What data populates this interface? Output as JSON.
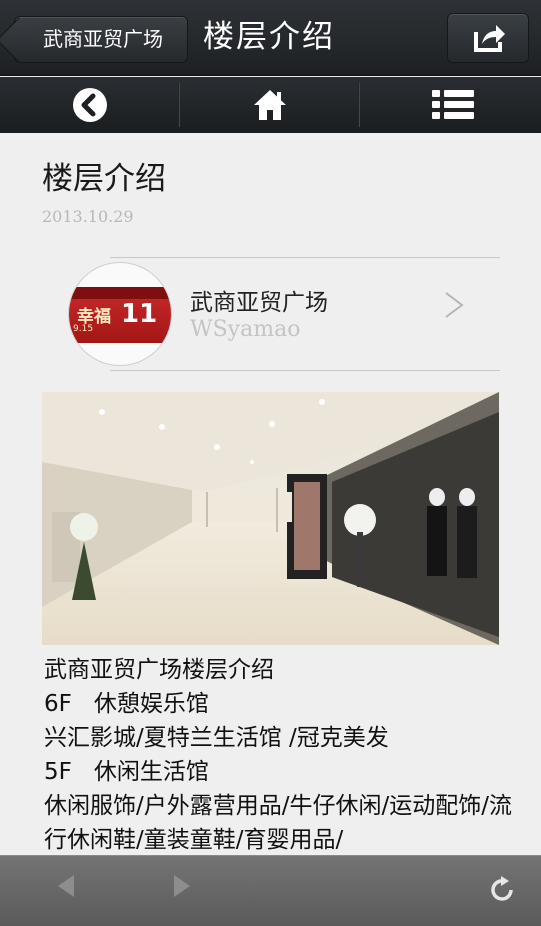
{
  "header": {
    "back_label": "武商亚贸广场",
    "title": "楼层介绍"
  },
  "nav": {
    "items": [
      {
        "icon": "back-circle-icon"
      },
      {
        "icon": "home-icon"
      },
      {
        "icon": "menu-list-icon"
      }
    ]
  },
  "article": {
    "title": "楼层介绍",
    "date": "2013.10.29",
    "account": {
      "name": "武商亚贸广场",
      "id": "WSyamao",
      "avatar_text_main": "幸福",
      "avatar_text_date": "9.15",
      "avatar_text_num": "11"
    },
    "lines": [
      "武商亚贸广场楼层介绍",
      {
        "floor": "6F",
        "name": "休憩娱乐馆"
      },
      "兴汇影城/夏特兰生活馆 /冠克美发",
      {
        "floor": "5F",
        "name": "休闲生活馆"
      },
      "休闲服饰/户外露营用品/牛仔休闲/运动配饰/流行休闲鞋/童装童鞋/育婴用品/"
    ]
  },
  "colors": {
    "topbar": "#25292c",
    "content_bg": "#efefef",
    "bottombar": "#666666",
    "brand_red": "#c92a2a"
  }
}
